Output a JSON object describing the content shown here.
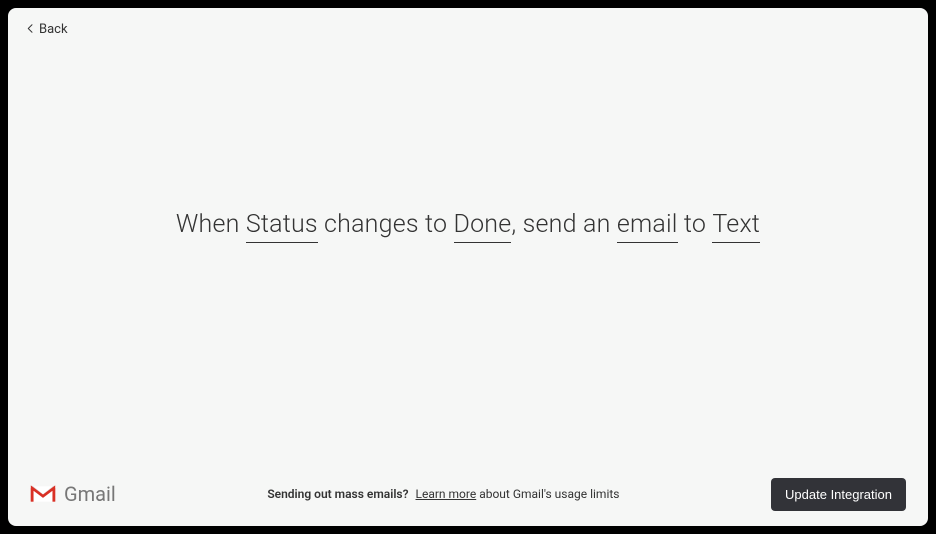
{
  "nav": {
    "back_label": "Back"
  },
  "sentence": {
    "part1": "When ",
    "status_token": "Status",
    "part2": " changes to ",
    "done_token": "Done",
    "part3": ", send an ",
    "email_token": "email",
    "part4": " to ",
    "text_token": "Text"
  },
  "footer": {
    "brand_name": "Gmail",
    "question": "Sending out mass emails?",
    "learn_more": "Learn more",
    "rest": " about Gmail's usage limits",
    "update_button": "Update Integration"
  }
}
